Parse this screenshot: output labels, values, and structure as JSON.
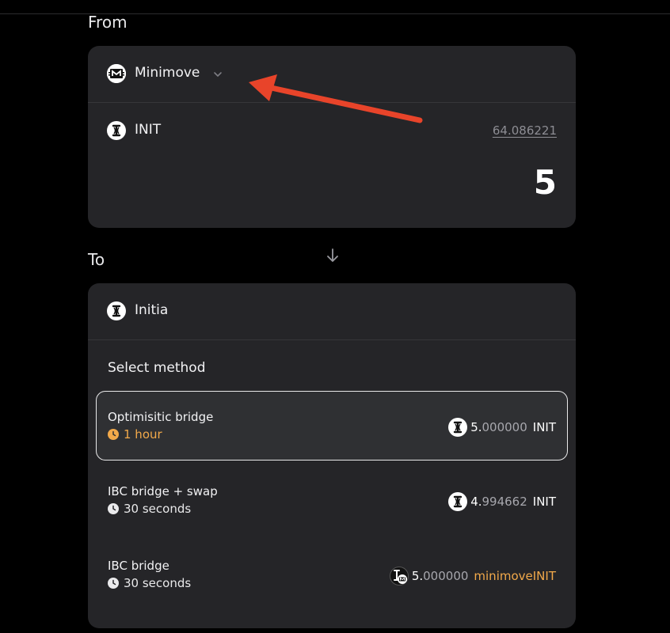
{
  "from": {
    "label": "From",
    "chain": "Minimove",
    "token": "INIT",
    "balance": "64.086221",
    "amount": "5"
  },
  "to": {
    "label": "To",
    "chain": "Initia",
    "select_method_label": "Select method",
    "methods": [
      {
        "name": "Optimisitic bridge",
        "duration": "1 hour",
        "amount_int": "5.",
        "amount_dec": "000000",
        "symbol": "INIT",
        "selected": true
      },
      {
        "name": "IBC bridge + swap",
        "duration": "30 seconds",
        "amount_int": "4.",
        "amount_dec": "994662",
        "symbol": "INIT",
        "selected": false
      },
      {
        "name": "IBC bridge",
        "duration": "30 seconds",
        "amount_int": "5.",
        "amount_dec": "000000",
        "symbol": "minimoveINIT",
        "selected": false
      }
    ]
  },
  "colors": {
    "background": "#000000",
    "card": "#252528",
    "accent_orange": "#f2a94a",
    "annotation_red": "#e8442a"
  },
  "icons": [
    "minimove-chain-icon",
    "chevron-down-icon",
    "initia-token-icon",
    "down-arrow-icon",
    "clock-icon",
    "annotation-arrow"
  ]
}
